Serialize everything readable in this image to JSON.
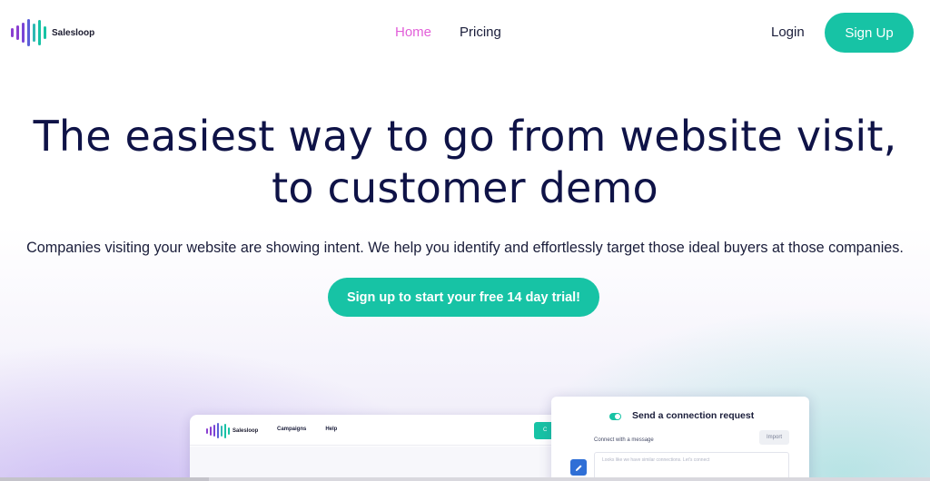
{
  "brand": {
    "name": "Salesloop",
    "colors": {
      "accent": "#17c3a5",
      "active_link": "#e25fd9",
      "heading": "#0f1347",
      "logo_purple": "#8a3fd1",
      "logo_teal": "#17c3a5"
    }
  },
  "nav": {
    "links": [
      {
        "label": "Home",
        "active": true
      },
      {
        "label": "Pricing",
        "active": false
      }
    ],
    "login_label": "Login",
    "signup_label": "Sign Up"
  },
  "hero": {
    "headline_line1": "The easiest way to go from website visit,",
    "headline_line2": "to customer demo",
    "subtitle": "Companies visiting your website are showing intent. We help you identify and effortlessly target those ideal buyers at those companies.",
    "cta_label": "Sign up to start your free 14 day trial!"
  },
  "preview": {
    "app": {
      "logo_text": "Salesloop",
      "nav": [
        "Campaigns",
        "Help"
      ],
      "button_label": "C"
    },
    "connection_card": {
      "title": "Send a connection request",
      "message_label": "Connect with a message",
      "import_label": "Import",
      "textarea_placeholder": "Looks like we have similar connections. Let's connect",
      "edit_icon": "pencil-icon"
    }
  }
}
